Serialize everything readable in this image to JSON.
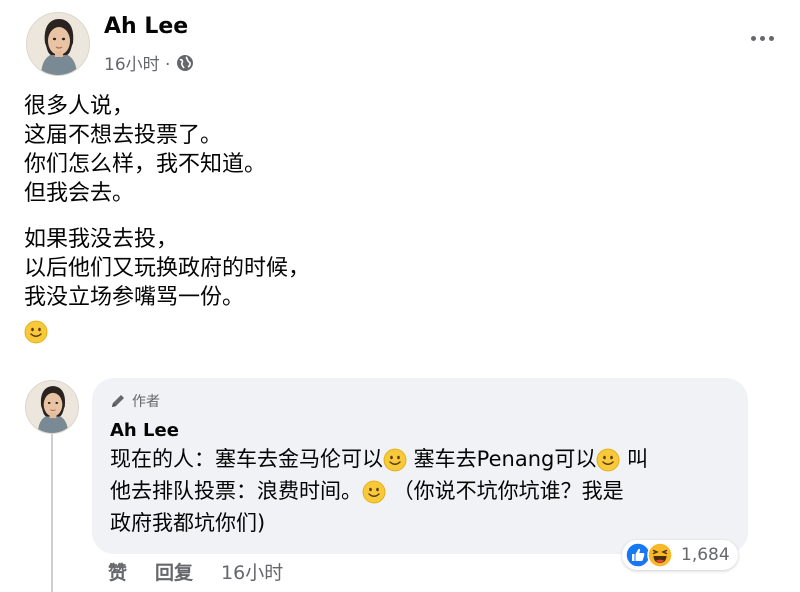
{
  "post": {
    "author": "Ah Lee",
    "time": "16小时 ·",
    "body": {
      "para1": [
        "很多人说，",
        "这届不想去投票了。",
        "你们怎么样，我不知道。",
        "但我会去。"
      ],
      "para2": [
        "如果我没去投，",
        "以后他们又玩换政府的时候，",
        "我没立场参嘴骂一份。"
      ]
    },
    "icons": {
      "privacy": "globe-icon",
      "more": "more-options-icon",
      "emoji": "slightly-smiling-face-emoji"
    }
  },
  "comment": {
    "badge": "作者",
    "author": "Ah Lee",
    "line1a": "现在的人：塞车去金马伦可以",
    "line1b": " 塞车去Penang可以",
    "line1c": " 叫",
    "line2a": "他去排队投票：浪费时间。",
    "line2b": " （你说不坑你坑谁？我是",
    "line3": "政府我都坑你们)",
    "reaction_count": "1,684",
    "reaction_icons": [
      "like-icon",
      "haha-icon"
    ],
    "actions": {
      "like": "赞",
      "reply": "回复",
      "time": "16小时"
    }
  },
  "colors": {
    "like_blue": "#1877f2",
    "haha_yellow": "#f7b928",
    "secondary_text": "#65676b",
    "bubble_bg": "#f0f2f5"
  }
}
